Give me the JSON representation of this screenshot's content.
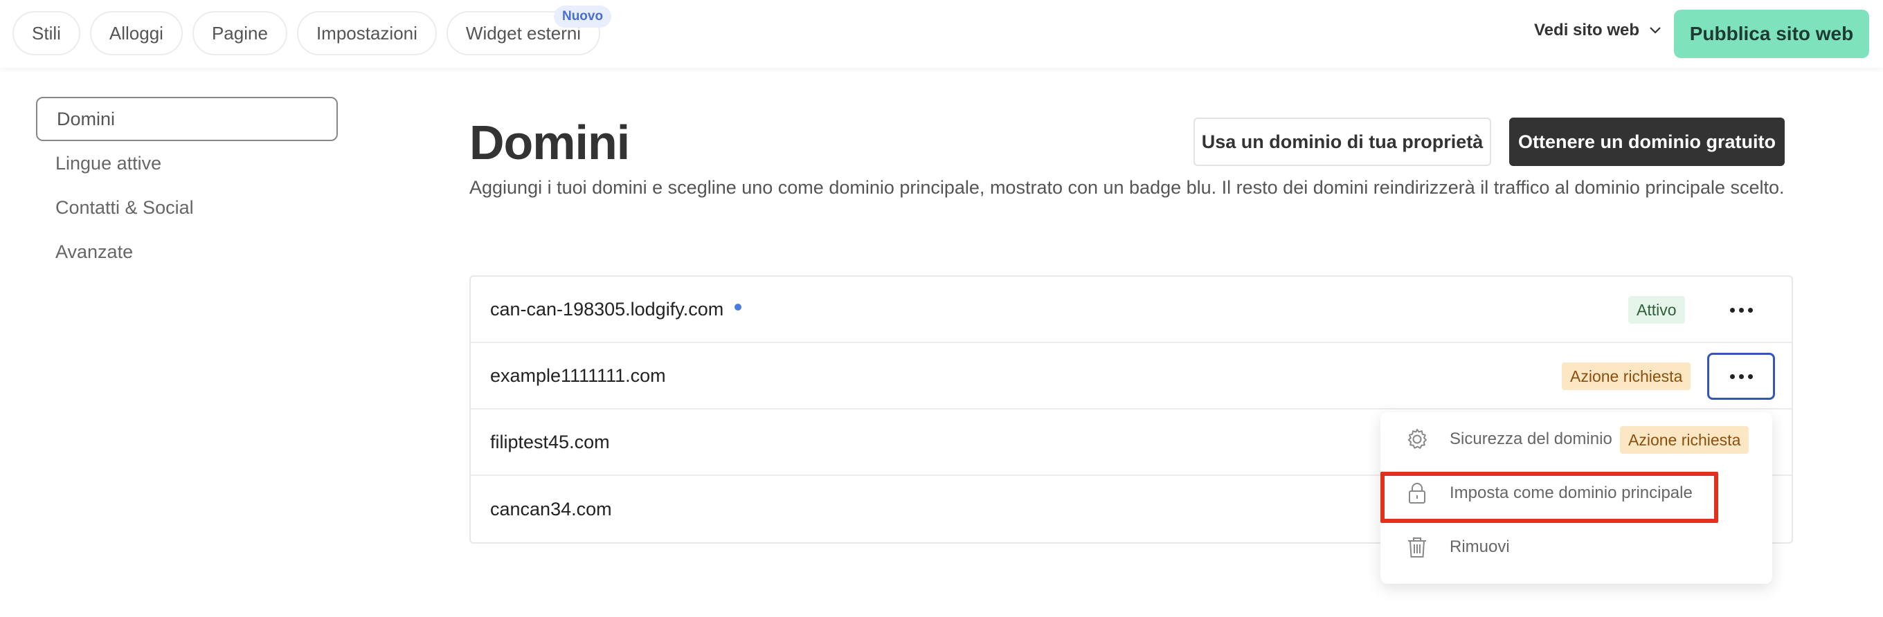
{
  "topbar": {
    "tabs": [
      {
        "label": "Stili"
      },
      {
        "label": "Alloggi"
      },
      {
        "label": "Pagine"
      },
      {
        "label": "Impostazioni"
      },
      {
        "label": "Widget esterni",
        "badge": "Nuovo"
      }
    ],
    "view_site_label": "Vedi sito web",
    "publish_label": "Pubblica sito web"
  },
  "sidebar": {
    "items": [
      {
        "label": "Domini",
        "active": true
      },
      {
        "label": "Lingue attive"
      },
      {
        "label": "Contatti & Social"
      },
      {
        "label": "Avanzate"
      }
    ]
  },
  "main": {
    "title": "Domini",
    "subtitle": "Aggiungi i tuoi domini e scegline uno come dominio principale, mostrato con un badge blu. Il resto dei domini reindirizzerà il traffico al dominio principale scelto.",
    "own_domain_button": "Usa un dominio di tua proprietà",
    "free_domain_button": "Ottenere un dominio gratuito",
    "domains": [
      {
        "name": "can-can-198305.lodgify.com",
        "primary": true,
        "status": "Attivo"
      },
      {
        "name": "example1111111.com",
        "status": "Azione richiesta"
      },
      {
        "name": "filiptest45.com"
      },
      {
        "name": "cancan34.com"
      }
    ]
  },
  "menu": {
    "items": [
      {
        "label": "Sicurezza del dominio",
        "badge": "Azione richiesta",
        "icon": "gear-icon"
      },
      {
        "label": "Imposta come dominio principale",
        "icon": "lock-icon"
      },
      {
        "label": "Rimuovi",
        "icon": "trash-icon"
      }
    ]
  },
  "colors": {
    "publish_bg": "#7ee3bd",
    "primary_dot": "#4a7be0",
    "highlight": "#e0321b",
    "focus": "#3656b6"
  }
}
